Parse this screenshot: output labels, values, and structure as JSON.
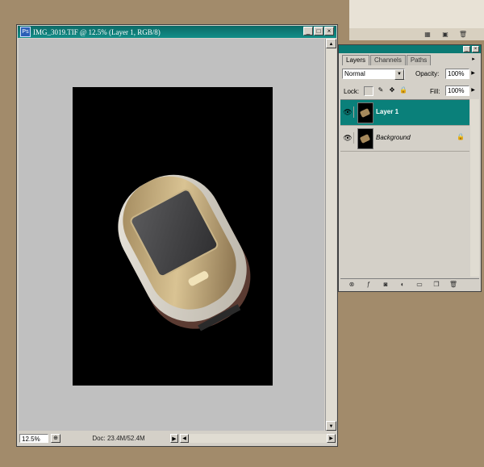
{
  "top_palette": {
    "icons": [
      "palette-icon",
      "camera-icon",
      "trash-icon"
    ],
    "icon_glyphs": [
      "▦",
      "▣",
      "🗑"
    ]
  },
  "document": {
    "title": "IMG_3019.TIF @ 12.5% (Layer 1, RGB/8)",
    "window_buttons": [
      "_",
      "□",
      "×"
    ],
    "zoom": "12.5%",
    "doc_info": "Doc: 23.4M/52.4M"
  },
  "layers_palette": {
    "tabs": [
      "Layers",
      "Channels",
      "Paths"
    ],
    "active_tab": "Layers",
    "blend_mode": "Normal",
    "opacity_label": "Opacity:",
    "opacity": "100%",
    "lock_label": "Lock:",
    "fill_label": "Fill:",
    "fill": "100%",
    "layers": [
      {
        "name": "Layer 1",
        "visible": true,
        "selected": true
      },
      {
        "name": "Background",
        "visible": true,
        "selected": false,
        "locked": true
      }
    ],
    "bottom_icons": [
      "link-icon",
      "layer-style-icon",
      "mask-icon",
      "adjustment-layer-icon",
      "folder-icon",
      "new-layer-icon",
      "trash-icon"
    ]
  },
  "colors": {
    "desktop": "#a28b6b",
    "titlebar": "#0c6a66",
    "selection": "#0a807a",
    "canvas_bg": "#c0c0c0"
  }
}
